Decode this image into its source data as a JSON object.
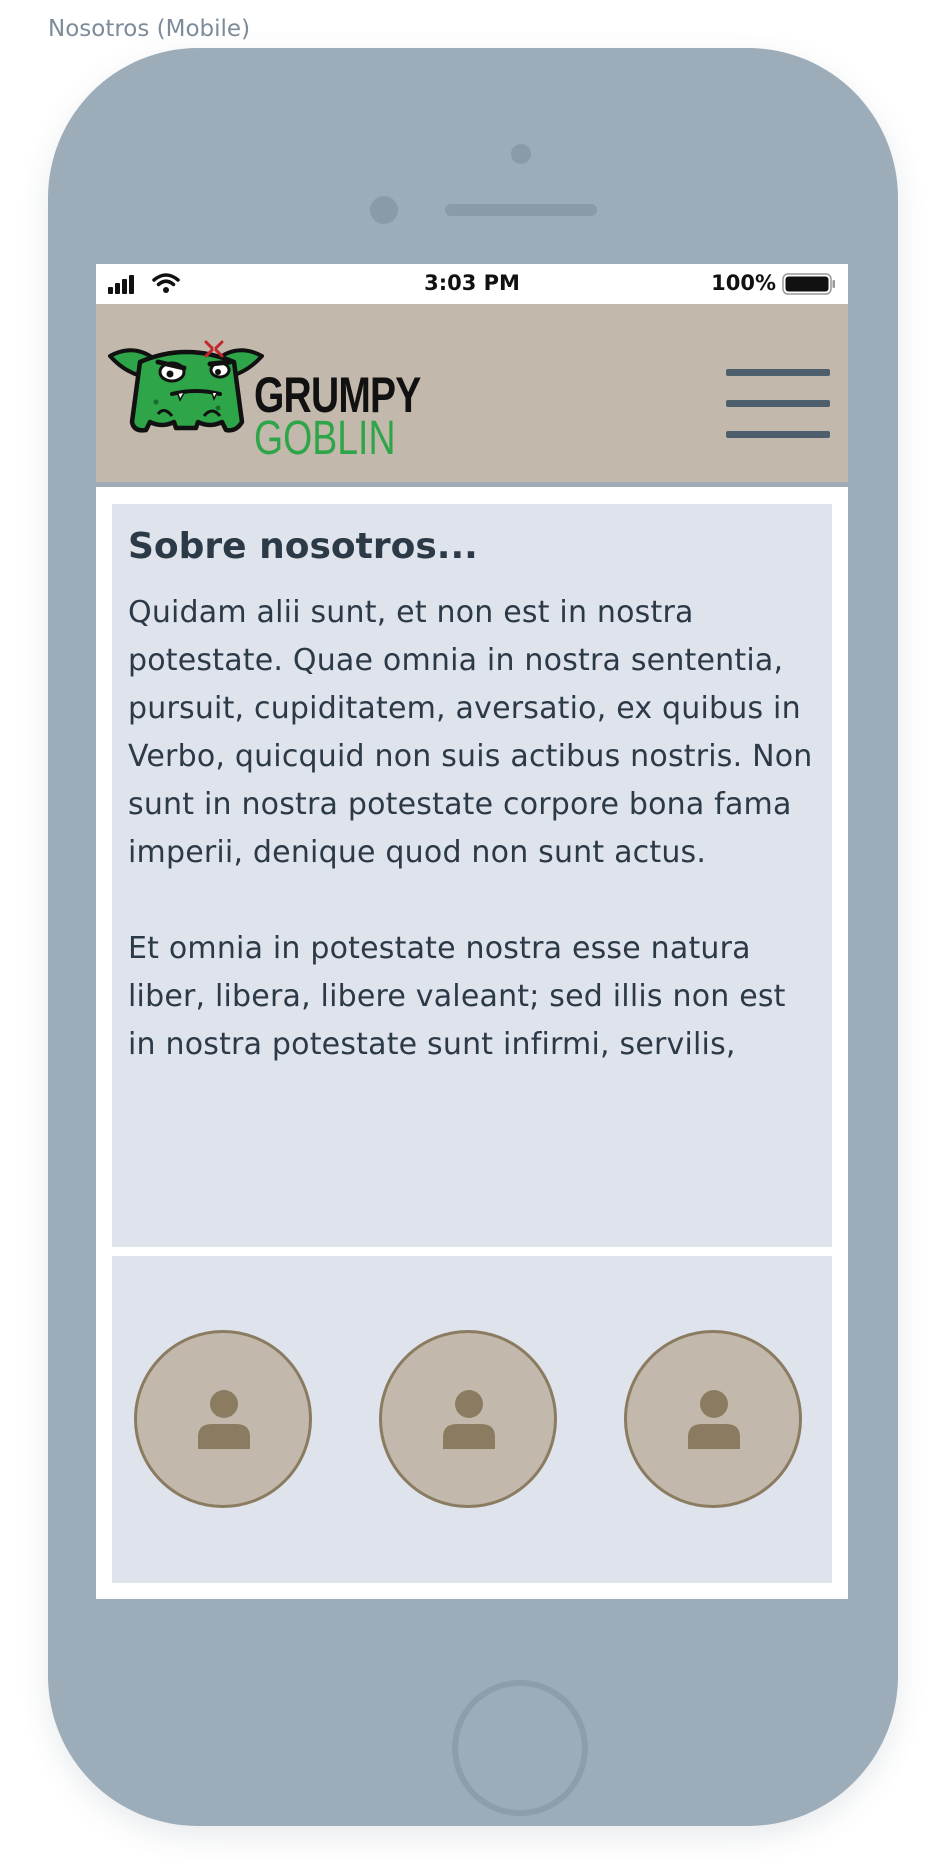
{
  "frame_label": "Nosotros (Mobile)",
  "status_bar": {
    "time": "3:03 PM",
    "battery": "100%"
  },
  "header": {
    "logo_line1": "GRUMPY",
    "logo_line2": "GOBLIN",
    "menu_icon": "hamburger-menu-icon"
  },
  "about": {
    "title": "Sobre nosotros...",
    "paragraph1": "Quidam alii sunt, et non est in nostra potestate. Quae omnia in nostra sententia, pursuit, cupiditatem, aversatio, ex quibus in Verbo, quicquid non suis actibus nostris. Non sunt in nostra potestate corpore bona fama imperii, denique quod non sunt actus.",
    "paragraph2": "Et omnia in potestate nostra esse natura liber, libera, libere valeant; sed illis non est in nostra potestate sunt infirmi, servilis,"
  },
  "team": {
    "members": [
      {
        "icon": "user-icon"
      },
      {
        "icon": "user-icon"
      },
      {
        "icon": "user-icon"
      }
    ]
  },
  "colors": {
    "phone_body": "#9dacb9",
    "header_bg": "#c2b9ac",
    "card_bg": "#dee3ec",
    "text": "#2c3a47",
    "accent_green": "#2da548",
    "avatar_border": "#8b7c61"
  }
}
